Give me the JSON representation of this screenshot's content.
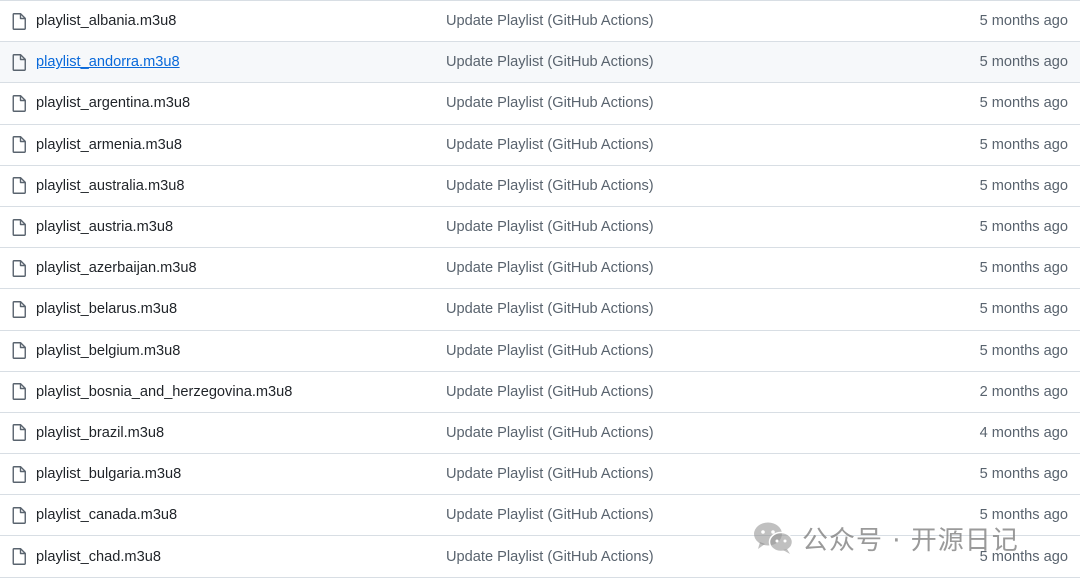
{
  "files": [
    {
      "name": "playlist_albania.m3u8",
      "commit": "Update Playlist (GitHub Actions)",
      "age": "5 months ago",
      "icon": "file-icon"
    },
    {
      "name": "playlist_andorra.m3u8",
      "commit": "Update Playlist (GitHub Actions)",
      "age": "5 months ago",
      "icon": "file-icon",
      "hovered": true
    },
    {
      "name": "playlist_argentina.m3u8",
      "commit": "Update Playlist (GitHub Actions)",
      "age": "5 months ago",
      "icon": "file-icon"
    },
    {
      "name": "playlist_armenia.m3u8",
      "commit": "Update Playlist (GitHub Actions)",
      "age": "5 months ago",
      "icon": "file-icon"
    },
    {
      "name": "playlist_australia.m3u8",
      "commit": "Update Playlist (GitHub Actions)",
      "age": "5 months ago",
      "icon": "file-icon"
    },
    {
      "name": "playlist_austria.m3u8",
      "commit": "Update Playlist (GitHub Actions)",
      "age": "5 months ago",
      "icon": "file-icon"
    },
    {
      "name": "playlist_azerbaijan.m3u8",
      "commit": "Update Playlist (GitHub Actions)",
      "age": "5 months ago",
      "icon": "file-icon"
    },
    {
      "name": "playlist_belarus.m3u8",
      "commit": "Update Playlist (GitHub Actions)",
      "age": "5 months ago",
      "icon": "file-icon"
    },
    {
      "name": "playlist_belgium.m3u8",
      "commit": "Update Playlist (GitHub Actions)",
      "age": "5 months ago",
      "icon": "file-icon"
    },
    {
      "name": "playlist_bosnia_and_herzegovina.m3u8",
      "commit": "Update Playlist (GitHub Actions)",
      "age": "2 months ago",
      "icon": "file-icon"
    },
    {
      "name": "playlist_brazil.m3u8",
      "commit": "Update Playlist (GitHub Actions)",
      "age": "4 months ago",
      "icon": "file-icon"
    },
    {
      "name": "playlist_bulgaria.m3u8",
      "commit": "Update Playlist (GitHub Actions)",
      "age": "5 months ago",
      "icon": "file-icon"
    },
    {
      "name": "playlist_canada.m3u8",
      "commit": "Update Playlist (GitHub Actions)",
      "age": "5 months ago",
      "icon": "file-icon"
    },
    {
      "name": "playlist_chad.m3u8",
      "commit": "Update Playlist (GitHub Actions)",
      "age": "5 months ago",
      "icon": "file-icon"
    }
  ],
  "watermark": {
    "text": "公众号 · 开源日记",
    "icon": "wechat-icon"
  },
  "colors": {
    "link_hover": "#0969da",
    "row_hover_bg": "#f6f8fa",
    "border": "#d8dee4",
    "text_primary": "#1f2328",
    "text_muted": "#59636e"
  }
}
